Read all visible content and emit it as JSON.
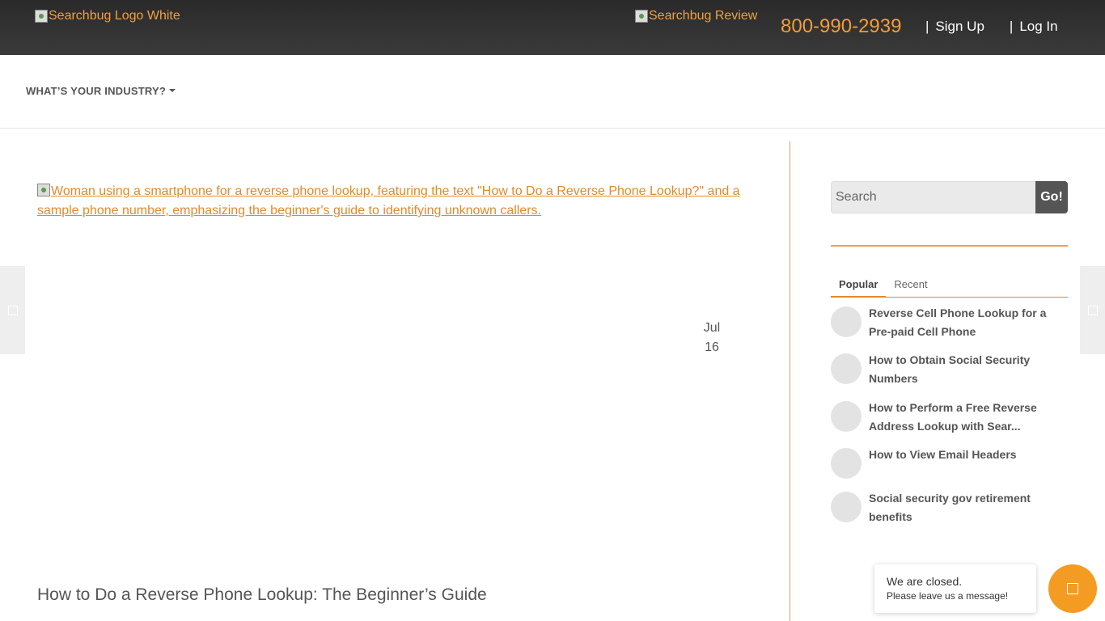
{
  "header": {
    "logo_alt": "Searchbug Logo White",
    "review_alt": "Searchbug Review",
    "phone": "800-990-2939",
    "separator": "|",
    "signup_label": "Sign Up",
    "login_label": "Log In"
  },
  "industry_menu": {
    "label": "WHAT’S YOUR INDUSTRY?"
  },
  "main": {
    "hero_image_alt": "Woman using a smartphone for a reverse phone lookup, featuring the text \"How to Do a Reverse Phone Lookup?\" and a sample phone number, emphasizing the beginner's guide to identifying unknown callers.",
    "date_month": "Jul",
    "date_day": "16",
    "post_title": "How to Do a Reverse Phone Lookup: The Beginner’s Guide"
  },
  "sidebar": {
    "search_placeholder": "Search",
    "go_label": "Go!",
    "tabs": [
      {
        "label": "Popular",
        "active": true
      },
      {
        "label": "Recent",
        "active": false
      }
    ],
    "posts": [
      {
        "title": "Reverse Cell Phone Lookup for a Pre-paid Cell Phone"
      },
      {
        "title": "How to Obtain Social Security Numbers"
      },
      {
        "title": "How to Perform a Free Reverse Address Lookup with Sear..."
      },
      {
        "title": "How to View Email Headers"
      },
      {
        "title": "Social security gov retirement benefits"
      }
    ]
  },
  "chat": {
    "status": "We are closed.",
    "prompt": "Please leave us a message!"
  },
  "colors": {
    "accent": "#f39c21",
    "link": "#e08a2b",
    "header_bg": "#333333"
  }
}
